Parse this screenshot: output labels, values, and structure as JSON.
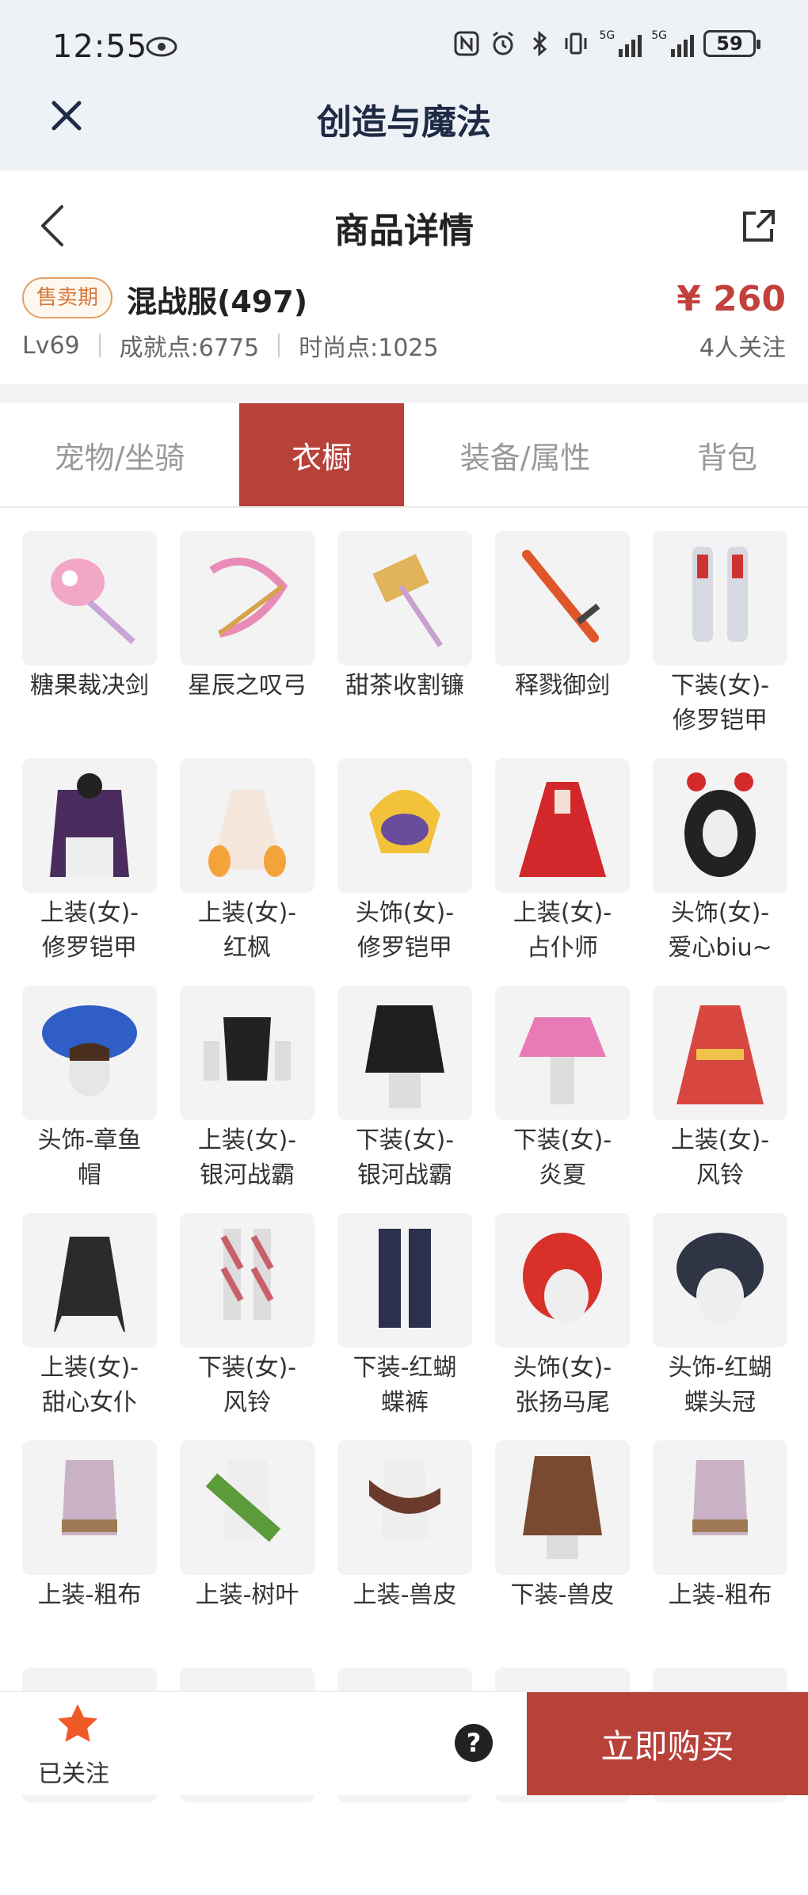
{
  "status": {
    "time": "12:55",
    "battery": "59"
  },
  "app": {
    "title": "创造与魔法"
  },
  "nav": {
    "title": "商品详情"
  },
  "product": {
    "badge": "售卖期",
    "name": "混战服(497)",
    "price": "¥ 260",
    "level": "Lv69",
    "achievement": "成就点:6775",
    "fashion": "时尚点:1025",
    "followers": "4人关注"
  },
  "tabs": [
    "宠物/坐骑",
    "衣橱",
    "装备/属性",
    "背包"
  ],
  "active_tab": "衣橱",
  "items": [
    {
      "label": "糖果裁决剑",
      "icon": "candy-sword",
      "color": "#f2a7c7"
    },
    {
      "label": "星辰之叹弓",
      "icon": "bow",
      "color": "#e98bb7"
    },
    {
      "label": "甜茶收割镰",
      "icon": "scythe",
      "color": "#e1b35a"
    },
    {
      "label": "释戮御剑",
      "icon": "sword",
      "color": "#e0562b"
    },
    {
      "label": "下装(女)-\n修罗铠甲",
      "icon": "boots",
      "color": "#d7d9e2"
    },
    {
      "label": "上装(女)-\n修罗铠甲",
      "icon": "armor-top",
      "color": "#4a2d5e"
    },
    {
      "label": "上装(女)-\n红枫",
      "icon": "dress",
      "color": "#f4e6da"
    },
    {
      "label": "头饰(女)-\n修罗铠甲",
      "icon": "helmet",
      "color": "#f2c23a"
    },
    {
      "label": "上装(女)-\n占仆师",
      "icon": "red-dress",
      "color": "#d3282b"
    },
    {
      "label": "头饰(女)-\n爱心biu~",
      "icon": "hair-hearts",
      "color": "#222222"
    },
    {
      "label": "头饰-章鱼\n帽",
      "icon": "octopus-hat",
      "color": "#2f5ec7"
    },
    {
      "label": "上装(女)-\n银河战霸",
      "icon": "black-top",
      "color": "#222222"
    },
    {
      "label": "下装(女)-\n银河战霸",
      "icon": "black-skirt",
      "color": "#1e1e1e"
    },
    {
      "label": "下装(女)-\n炎夏",
      "icon": "pink-skirt",
      "color": "#e87ab6"
    },
    {
      "label": "上装(女)-\n风铃",
      "icon": "kimono",
      "color": "#d8473f"
    },
    {
      "label": "上装(女)-\n甜心女仆",
      "icon": "maid",
      "color": "#2b2b2b"
    },
    {
      "label": "下装(女)-\n风铃",
      "icon": "legs",
      "color": "#c8606a"
    },
    {
      "label": "下装-红蝴\n蝶裤",
      "icon": "pants",
      "color": "#2c2f4e"
    },
    {
      "label": "头饰(女)-\n张扬马尾",
      "icon": "red-hair",
      "color": "#d9302a"
    },
    {
      "label": "头饰-红蝴\n蝶头冠",
      "icon": "dark-hair",
      "color": "#2f3544"
    },
    {
      "label": "上装-粗布",
      "icon": "cloth-top",
      "color": "#c9b2c6"
    },
    {
      "label": "上装-树叶",
      "icon": "leaf-top",
      "color": "#5c9b3a"
    },
    {
      "label": "上装-兽皮",
      "icon": "hide-top",
      "color": "#6b3a2a"
    },
    {
      "label": "下装-兽皮",
      "icon": "hide-skirt",
      "color": "#7a4a30"
    },
    {
      "label": "上装-粗布",
      "icon": "cloth-top",
      "color": "#c9b2c6"
    },
    {
      "label": "",
      "icon": "partial",
      "color": "#b08878"
    },
    {
      "label": "",
      "icon": "partial",
      "color": "#6fb2c4"
    },
    {
      "label": "",
      "icon": "partial",
      "color": "#5c9b3a"
    },
    {
      "label": "",
      "icon": "partial",
      "color": "#5c9b3a"
    },
    {
      "label": "",
      "icon": "partial",
      "color": "#d0d0d0"
    }
  ],
  "bottom": {
    "followed": "已关注",
    "help": "?",
    "buy": "立即购买"
  },
  "colors": {
    "accent": "#b8413a",
    "price": "#c2413d",
    "badge": "#d9783a"
  }
}
